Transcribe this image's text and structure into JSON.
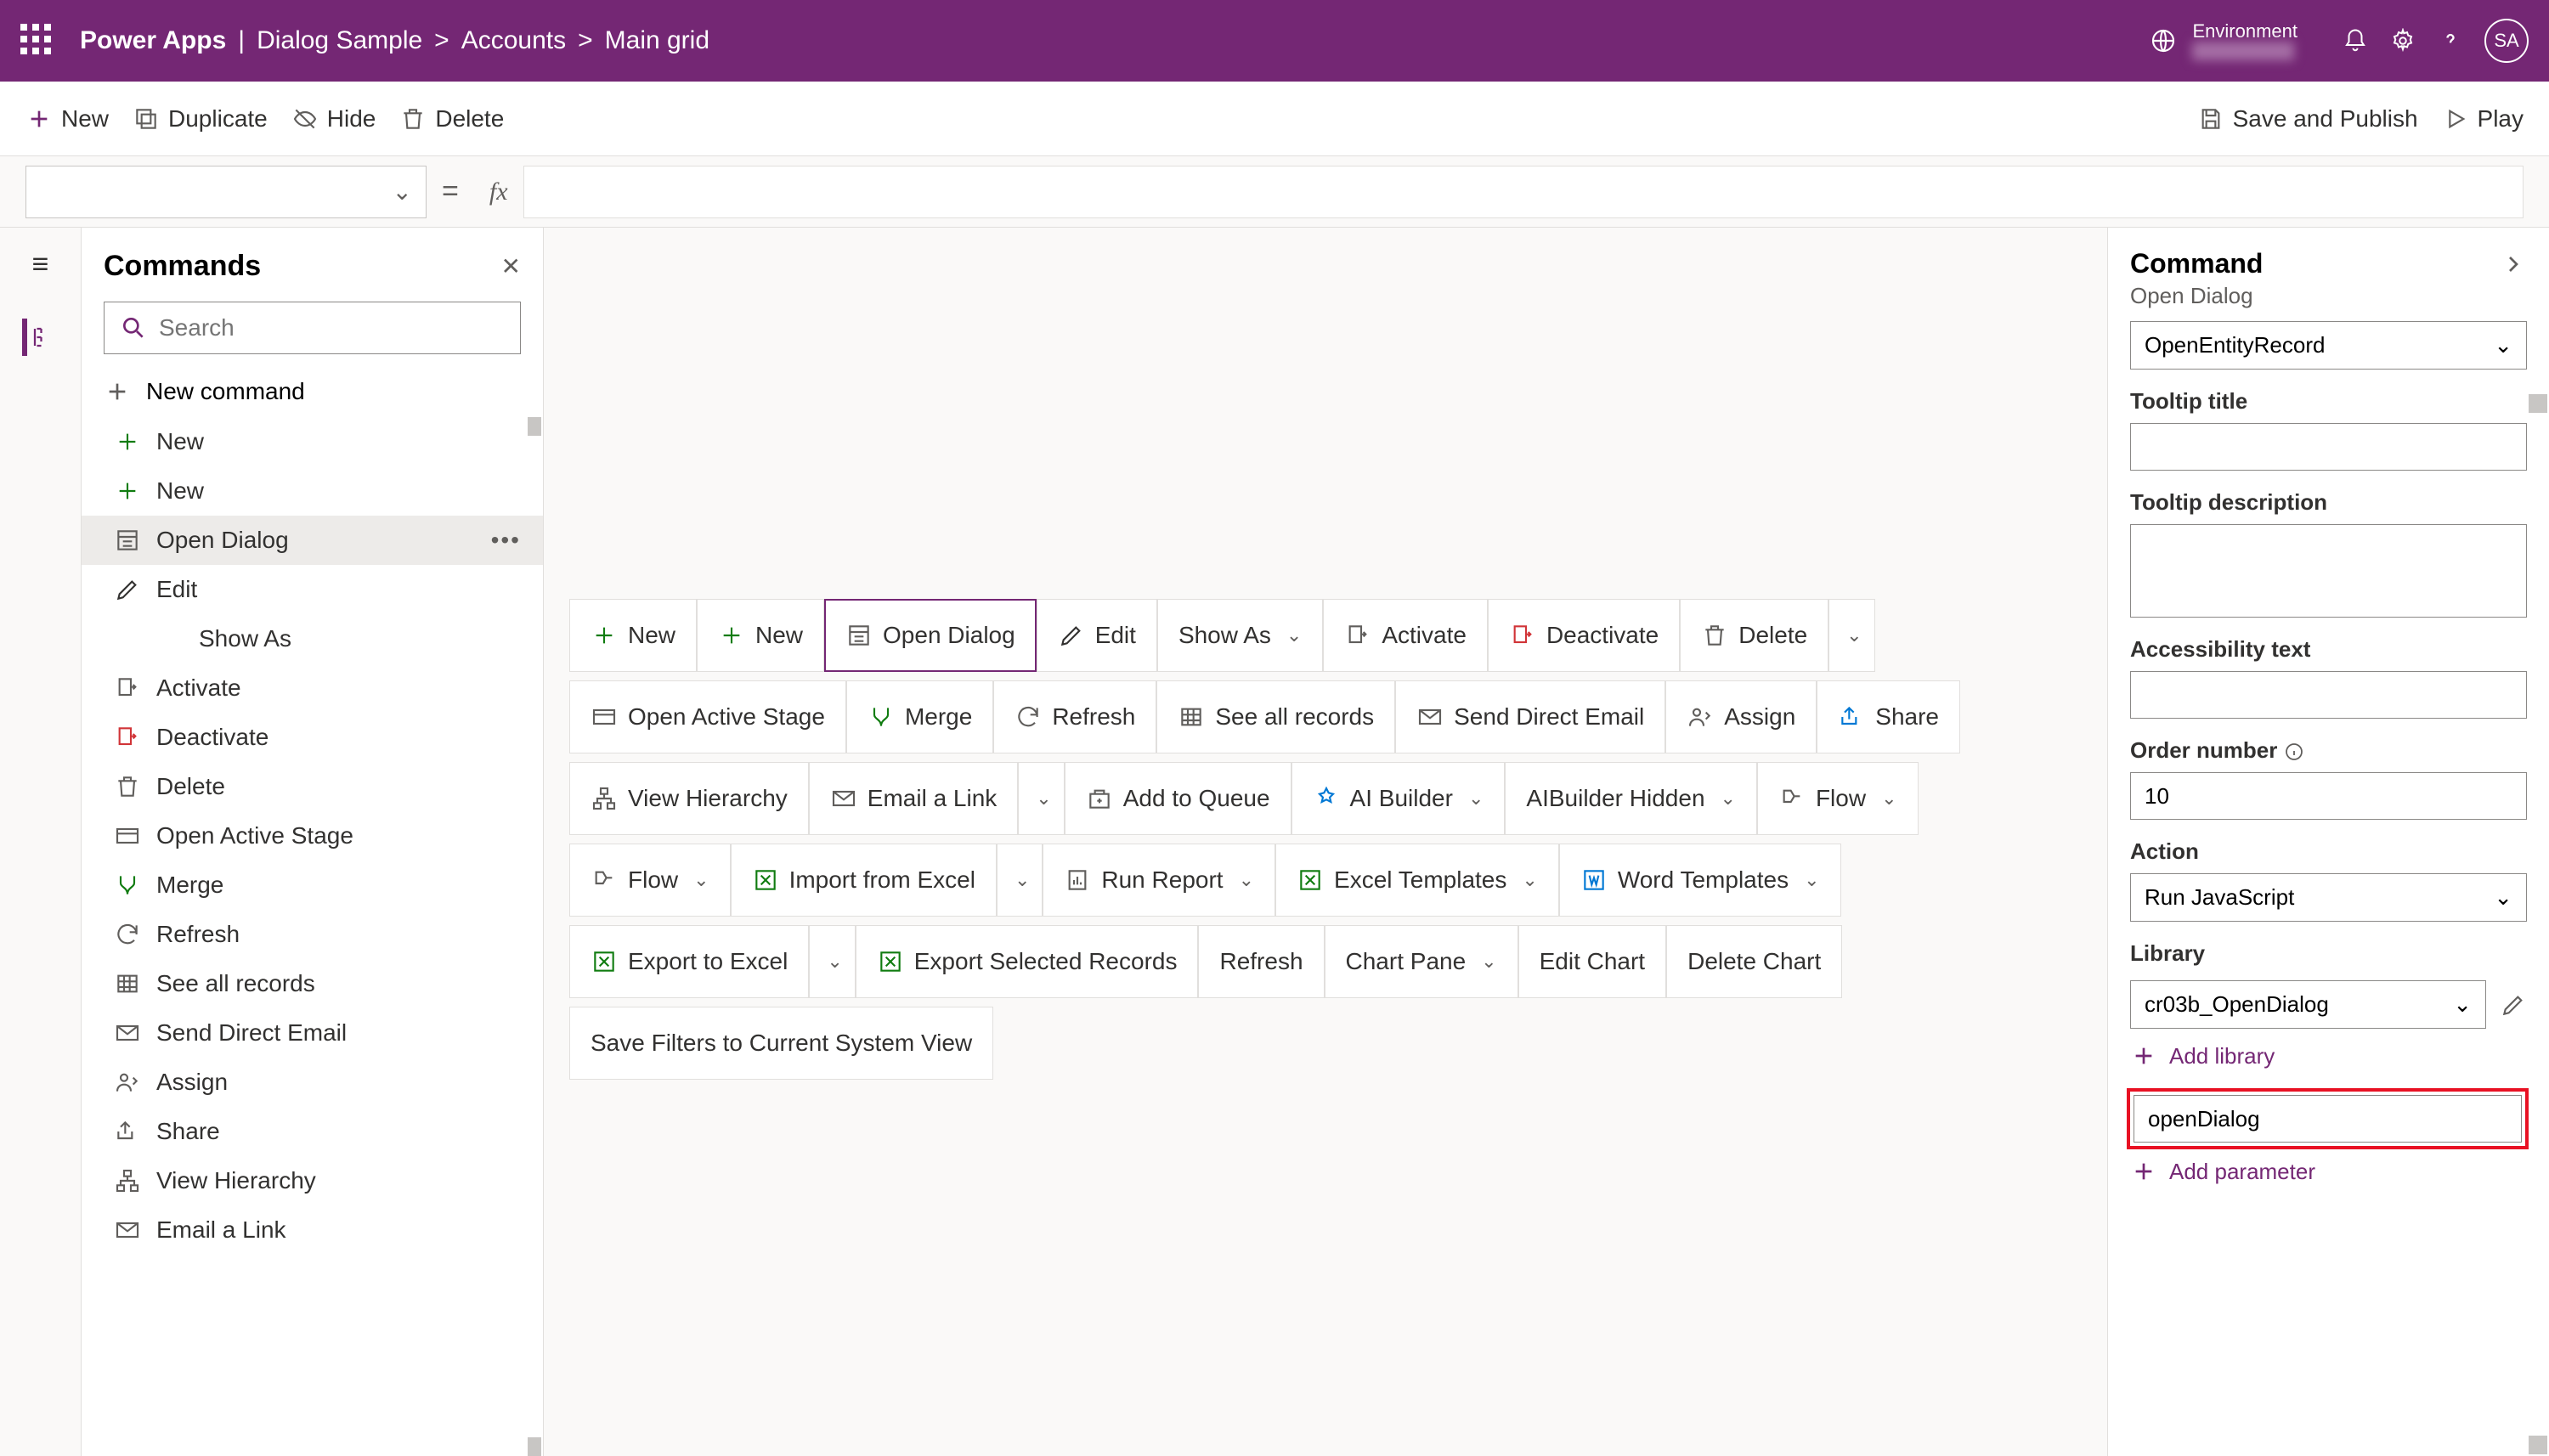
{
  "header": {
    "product": "Power Apps",
    "crumbs": [
      "Dialog Sample",
      "Accounts",
      "Main grid"
    ],
    "env_label": "Environment",
    "avatar": "SA"
  },
  "toolbar": {
    "new": "New",
    "duplicate": "Duplicate",
    "hide": "Hide",
    "delete": "Delete",
    "save_publish": "Save and Publish",
    "play": "Play"
  },
  "left": {
    "title": "Commands",
    "search_ph": "Search",
    "new_command": "New command",
    "items": [
      {
        "icon": "plus-green",
        "label": "New"
      },
      {
        "icon": "plus-green",
        "label": "New"
      },
      {
        "icon": "form",
        "label": "Open Dialog",
        "selected": true
      },
      {
        "icon": "pencil",
        "label": "Edit"
      },
      {
        "icon": "",
        "label": "Show As",
        "indent": true
      },
      {
        "icon": "activate",
        "label": "Activate"
      },
      {
        "icon": "deactivate",
        "label": "Deactivate"
      },
      {
        "icon": "trash",
        "label": "Delete"
      },
      {
        "icon": "stage",
        "label": "Open Active Stage"
      },
      {
        "icon": "merge",
        "label": "Merge"
      },
      {
        "icon": "refresh",
        "label": "Refresh"
      },
      {
        "icon": "records",
        "label": "See all records"
      },
      {
        "icon": "mail",
        "label": "Send Direct Email"
      },
      {
        "icon": "assign",
        "label": "Assign"
      },
      {
        "icon": "share",
        "label": "Share"
      },
      {
        "icon": "hierarchy",
        "label": "View Hierarchy"
      },
      {
        "icon": "maillink",
        "label": "Email a Link"
      }
    ]
  },
  "canvas": {
    "rows": [
      [
        {
          "icon": "plus-green",
          "label": "New"
        },
        {
          "icon": "plus-green",
          "label": "New"
        },
        {
          "icon": "form",
          "label": "Open Dialog",
          "selected": true
        },
        {
          "icon": "pencil",
          "label": "Edit"
        },
        {
          "label": "Show As",
          "chev": true
        },
        {
          "icon": "activate",
          "label": "Activate"
        },
        {
          "icon": "deactivate",
          "label": "Deactivate"
        },
        {
          "icon": "trash",
          "label": "Delete"
        },
        {
          "split_chev": true
        }
      ],
      [
        {
          "icon": "stage",
          "label": "Open Active Stage"
        },
        {
          "icon": "merge",
          "label": "Merge"
        },
        {
          "icon": "refresh",
          "label": "Refresh"
        },
        {
          "icon": "records",
          "label": "See all records"
        },
        {
          "icon": "mail",
          "label": "Send Direct Email"
        },
        {
          "icon": "assign",
          "label": "Assign"
        },
        {
          "icon": "share-blue",
          "label": "Share"
        }
      ],
      [
        {
          "icon": "hierarchy",
          "label": "View Hierarchy"
        },
        {
          "icon": "maillink",
          "label": "Email a Link"
        },
        {
          "split_chev": true
        },
        {
          "icon": "queue",
          "label": "Add to Queue"
        },
        {
          "icon": "ai",
          "label": "AI Builder",
          "chev": true
        },
        {
          "label": "AIBuilder Hidden",
          "chev": true
        },
        {
          "icon": "flow",
          "label": "Flow",
          "chev": true
        }
      ],
      [
        {
          "icon": "flow",
          "label": "Flow",
          "chev": true
        },
        {
          "icon": "xls-in",
          "label": "Import from Excel"
        },
        {
          "split_chev": true
        },
        {
          "icon": "report",
          "label": "Run Report",
          "chev": true
        },
        {
          "icon": "xls-t",
          "label": "Excel Templates",
          "chev": true
        },
        {
          "icon": "word-t",
          "label": "Word Templates",
          "chev": true
        }
      ],
      [
        {
          "icon": "xls-out",
          "label": "Export to Excel"
        },
        {
          "split_chev": true
        },
        {
          "icon": "xls-sel",
          "label": "Export Selected Records"
        },
        {
          "label": "Refresh"
        },
        {
          "label": "Chart Pane",
          "chev": true
        },
        {
          "label": "Edit Chart"
        },
        {
          "label": "Delete Chart"
        }
      ],
      [
        {
          "label": "Save Filters to Current System View"
        }
      ]
    ]
  },
  "right": {
    "title": "Command",
    "subtitle": "Open Dialog",
    "top_select": "OpenEntityRecord",
    "labels": {
      "tooltip_title": "Tooltip title",
      "tooltip_desc": "Tooltip description",
      "a11y": "Accessibility text",
      "order": "Order number",
      "action": "Action",
      "library": "Library",
      "add_library": "Add library",
      "add_parameter": "Add parameter"
    },
    "values": {
      "order": "10",
      "action": "Run JavaScript",
      "library": "cr03b_OpenDialog",
      "fn": "openDialog"
    }
  }
}
